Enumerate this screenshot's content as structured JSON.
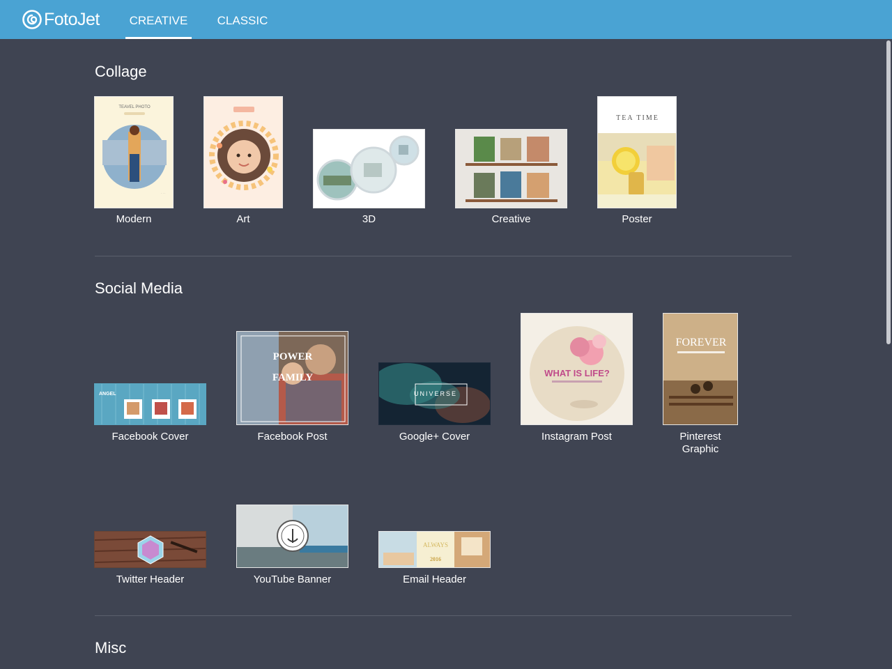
{
  "app": {
    "logo_text": "FotoJet"
  },
  "nav": {
    "tabs": [
      {
        "label": "CREATIVE",
        "active": true
      },
      {
        "label": "CLASSIC",
        "active": false
      }
    ]
  },
  "colors": {
    "topbar": "#4aa3d3",
    "background": "#3f4452",
    "divider": "#5b606d"
  },
  "sections": {
    "collage": {
      "title": "Collage",
      "items": [
        {
          "label": "Modern",
          "thumb_text": "TEAVEL PHOTO"
        },
        {
          "label": "Art"
        },
        {
          "label": "3D"
        },
        {
          "label": "Creative"
        },
        {
          "label": "Poster",
          "thumb_text": "TEA TIME"
        }
      ]
    },
    "social": {
      "title": "Social Media",
      "items": [
        {
          "label": "Facebook Cover",
          "thumb_text": "ANGEL"
        },
        {
          "label": "Facebook Post",
          "thumb_text": "POWER",
          "thumb_text2": "FAMILY"
        },
        {
          "label": "Google+ Cover",
          "thumb_text": "UNIVERSE"
        },
        {
          "label": "Instagram Post",
          "thumb_text": "WHAT IS LIFE?"
        },
        {
          "label": "Pinterest",
          "label2": "Graphic",
          "thumb_text": "FOREVER"
        },
        {
          "label": "Twitter Header"
        },
        {
          "label": "YouTube Banner"
        },
        {
          "label": "Email Header",
          "thumb_text": "ALWAYS",
          "thumb_text2": "2016"
        }
      ]
    },
    "misc": {
      "title": "Misc"
    }
  }
}
